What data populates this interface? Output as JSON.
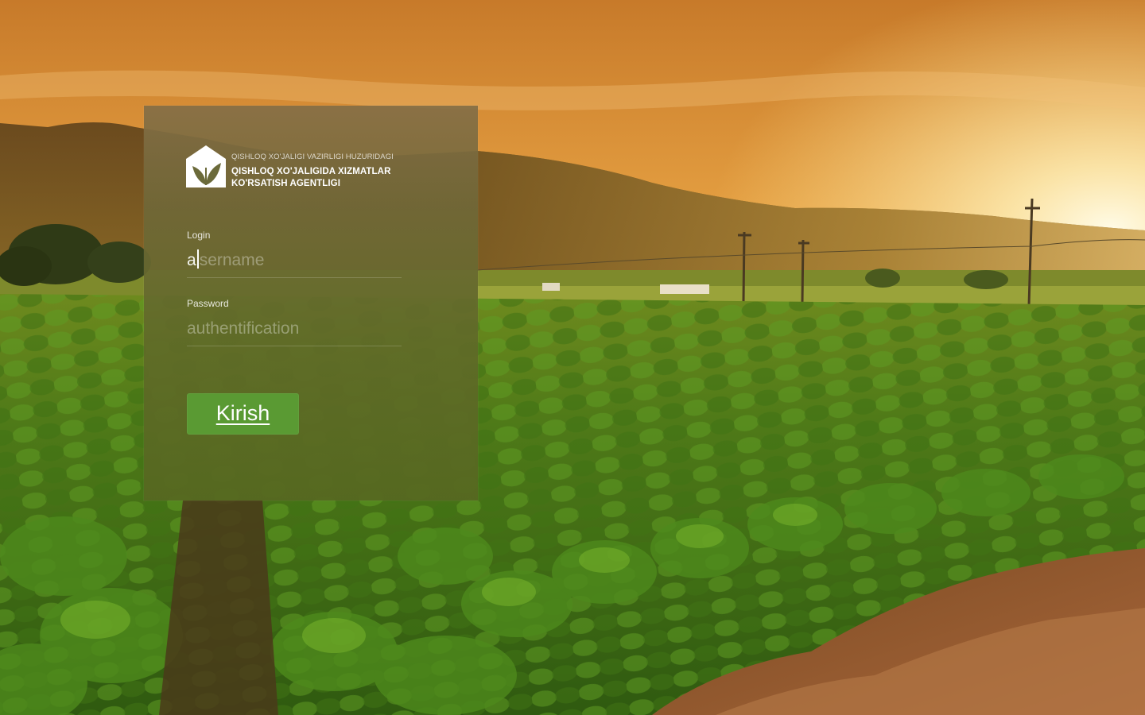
{
  "brand": {
    "org_top": "QISHLOQ XO'JALIGI VAZIRLIGI HUZURIDAGI",
    "org_line1": "QISHLOQ XO'JALIGIDA XIZMATLAR",
    "org_line2": "KO'RSATISH AGENTLIGI",
    "logo_icon": "house-leaf-logo"
  },
  "form": {
    "login_label": "Login",
    "login_value": "a",
    "login_placeholder": "sername",
    "password_label": "Password",
    "password_placeholder": "authentification",
    "submit_label": "Kirish"
  },
  "colors": {
    "button": "#5a9a33",
    "panel": "#5a6a2a",
    "sky": "#f0a030"
  }
}
